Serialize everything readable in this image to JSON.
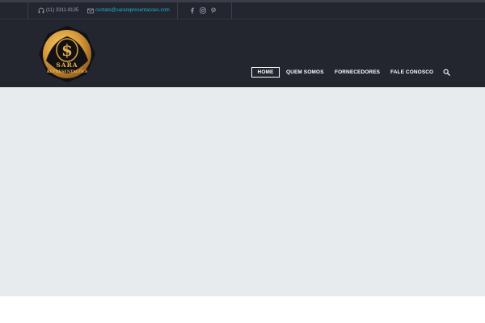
{
  "topbar": {
    "phone": "(11) 3311-9135",
    "email": "contato@sararepresentacoes.com",
    "icons": {
      "phone": "headphones-icon",
      "email": "envelope-icon"
    },
    "social": [
      "facebook-icon",
      "instagram-icon",
      "pinterest-icon"
    ]
  },
  "logo": {
    "line1": "SARA",
    "line2": "REPRESENTAÇÕES"
  },
  "nav": {
    "items": [
      "HOME",
      "QUEM SOMOS",
      "FORNECEDORES",
      "FALE CONOSCO"
    ],
    "active": "HOME",
    "search_icon": "search-icon"
  },
  "colors": {
    "header_bg": "#23252f",
    "accent_link": "#18b4c9",
    "gold": "#d79a3a",
    "content_bg": "#e8ebee"
  }
}
